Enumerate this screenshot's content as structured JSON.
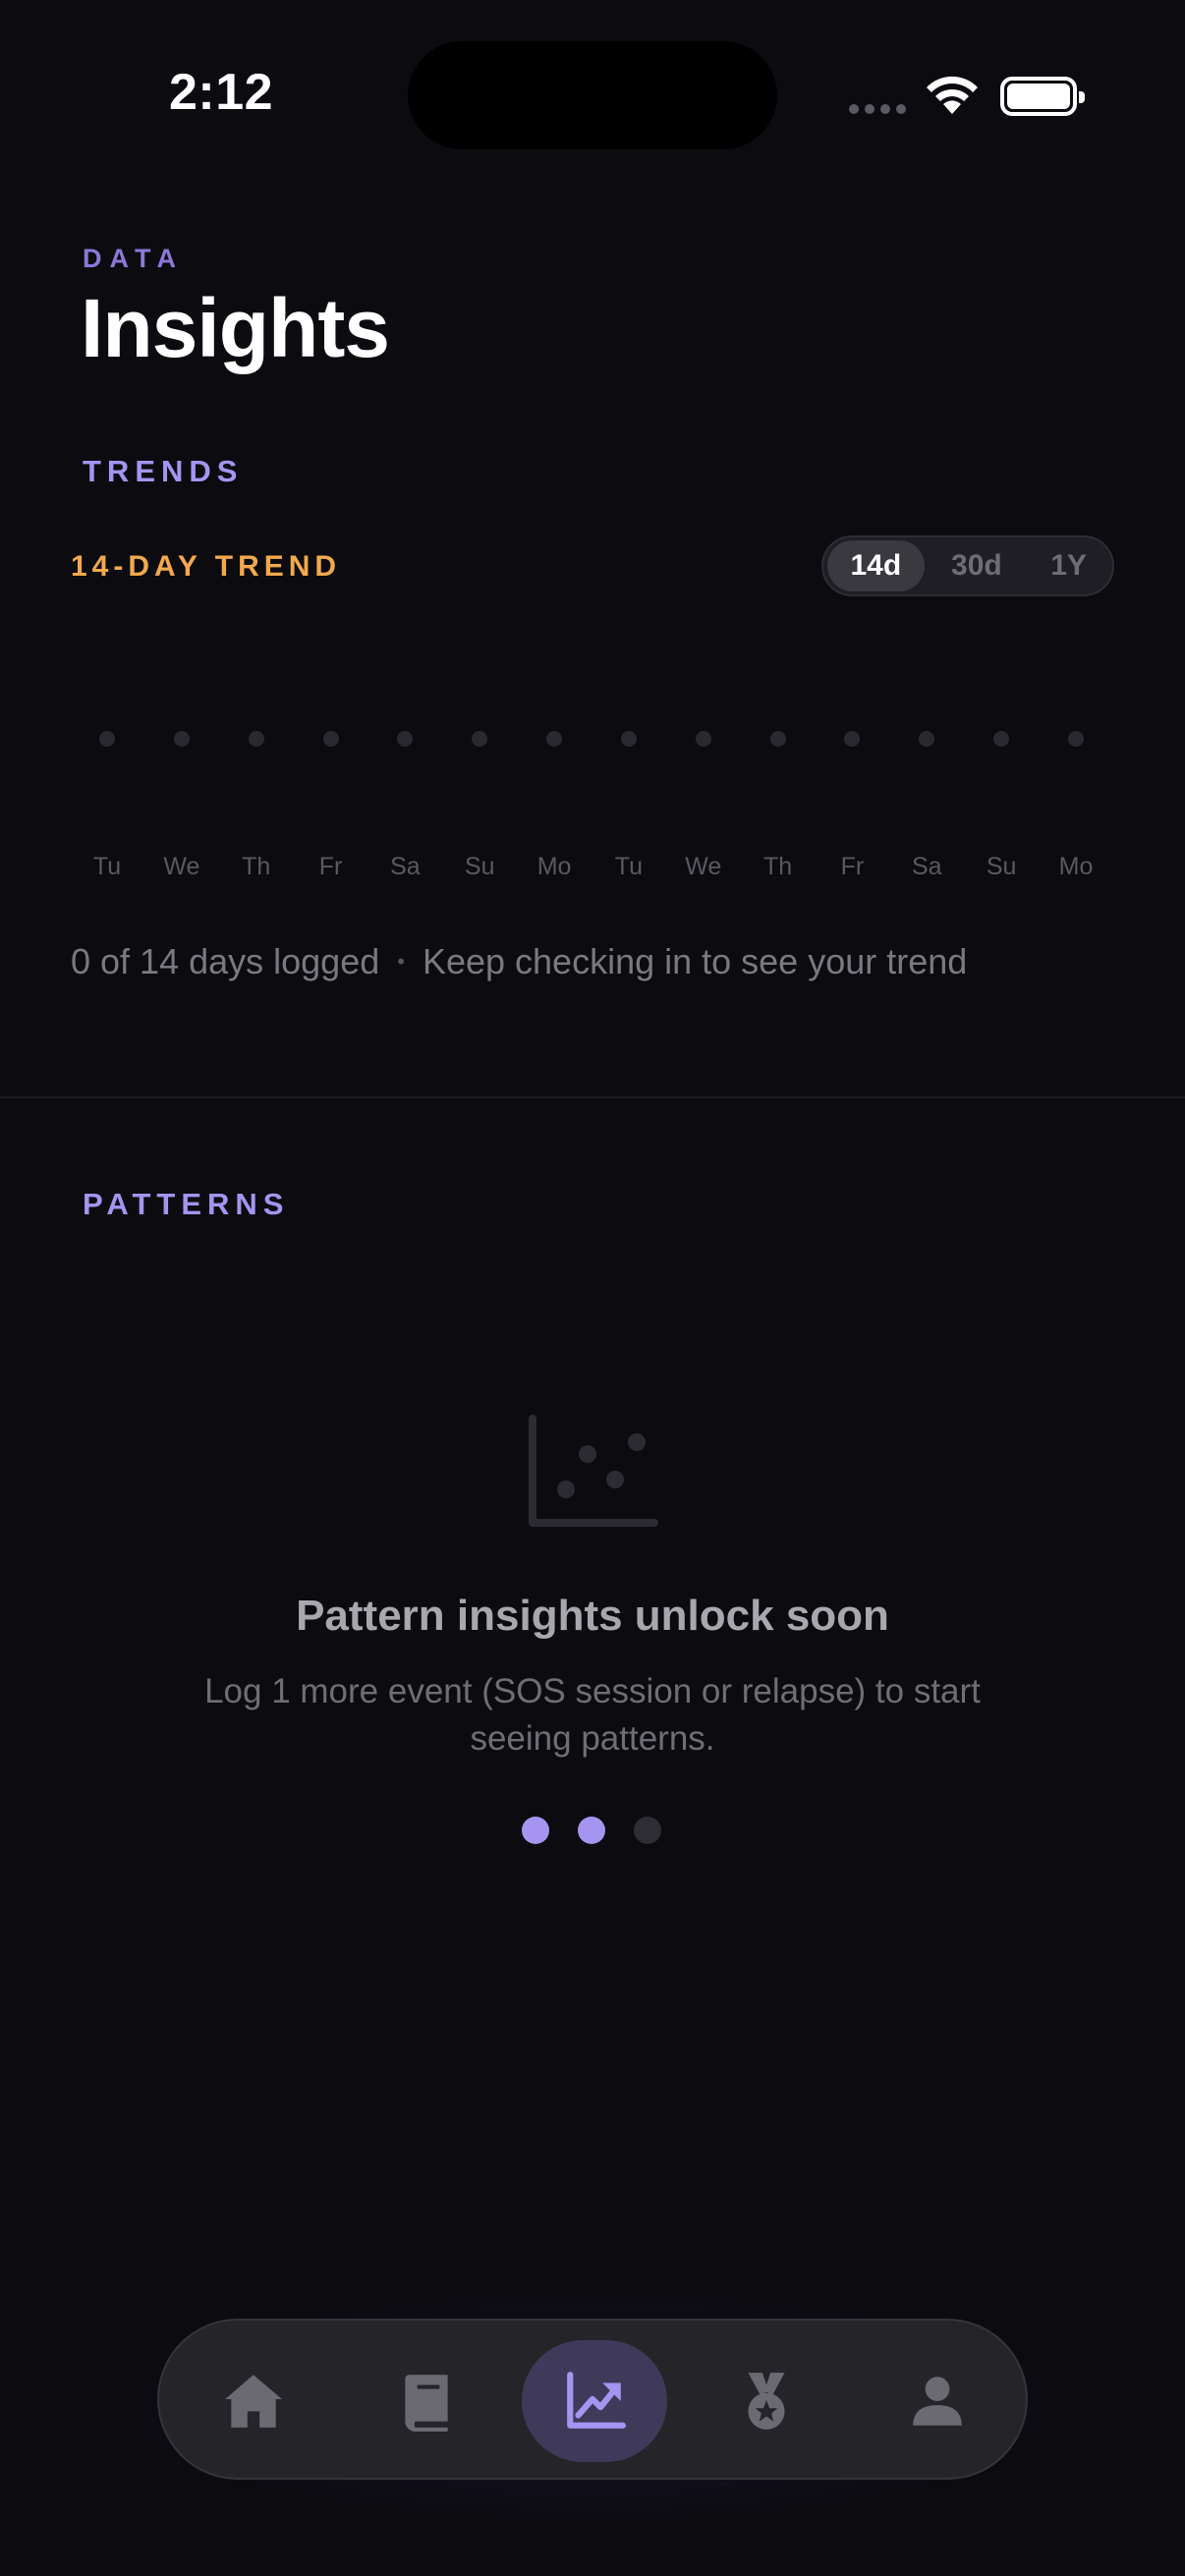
{
  "status_bar": {
    "time": "2:12"
  },
  "header": {
    "overline": "DATA",
    "title": "Insights"
  },
  "trends": {
    "section_label": "TRENDS",
    "trend_label": "14-DAY TREND",
    "ranges": [
      {
        "label": "14d",
        "selected": true
      },
      {
        "label": "30d",
        "selected": false
      },
      {
        "label": "1Y",
        "selected": false
      }
    ],
    "days": [
      "Tu",
      "We",
      "Th",
      "Fr",
      "Sa",
      "Su",
      "Mo",
      "Tu",
      "We",
      "Th",
      "Fr",
      "Sa",
      "Su",
      "Mo"
    ],
    "logged_text": "0 of 14 days logged",
    "separator": "•",
    "hint_text": "Keep checking in to see your trend"
  },
  "patterns": {
    "section_label": "PATTERNS",
    "icon": "scatter-chart-icon",
    "empty_title": "Pattern insights unlock soon",
    "empty_description": "Log 1 more event (SOS session or relapse) to start seeing patterns.",
    "progress": {
      "filled": 2,
      "total": 3
    }
  },
  "tab_bar": {
    "items": [
      {
        "icon": "home-icon",
        "active": false
      },
      {
        "icon": "journal-icon",
        "active": false
      },
      {
        "icon": "insights-icon",
        "active": true
      },
      {
        "icon": "achievements-icon",
        "active": false
      },
      {
        "icon": "profile-icon",
        "active": false
      }
    ]
  },
  "colors": {
    "background": "#0c0b10",
    "accent_purple": "#a594f0",
    "accent_orange": "#f2a94e",
    "active_tab": "#3f3a5a"
  }
}
